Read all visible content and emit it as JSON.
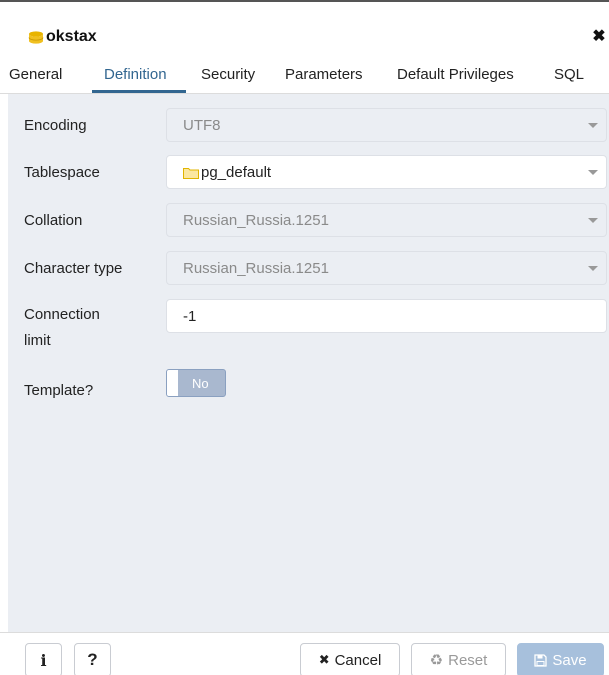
{
  "dialog": {
    "title": "okstax",
    "close_icon": "close-icon",
    "title_icon": "database-icon"
  },
  "tabs": [
    {
      "label": "General"
    },
    {
      "label": "Definition",
      "active": true
    },
    {
      "label": "Security"
    },
    {
      "label": "Parameters"
    },
    {
      "label": "Default Privileges"
    },
    {
      "label": "SQL"
    }
  ],
  "form": {
    "encoding": {
      "label": "Encoding",
      "value": "UTF8",
      "disabled": true
    },
    "tablespace": {
      "label": "Tablespace",
      "value": "pg_default",
      "icon": "folder-icon"
    },
    "collation": {
      "label": "Collation",
      "value": "Russian_Russia.1251",
      "disabled": true
    },
    "character_type": {
      "label": "Character type",
      "value": "Russian_Russia.1251",
      "disabled": true
    },
    "connection_limit": {
      "label_line1": "Connection",
      "label_line2": "limit",
      "value": "-1"
    },
    "template": {
      "label": "Template?",
      "toggle_value": "No"
    }
  },
  "footer": {
    "info_label": "i",
    "help_label": "?",
    "cancel_label": "Cancel",
    "reset_label": "Reset",
    "save_label": "Save"
  },
  "colors": {
    "accent": "#326690",
    "body_bg": "#ebeef3",
    "save_bg": "#a7c0dc",
    "toggle_bg": "#a9b8cf"
  }
}
